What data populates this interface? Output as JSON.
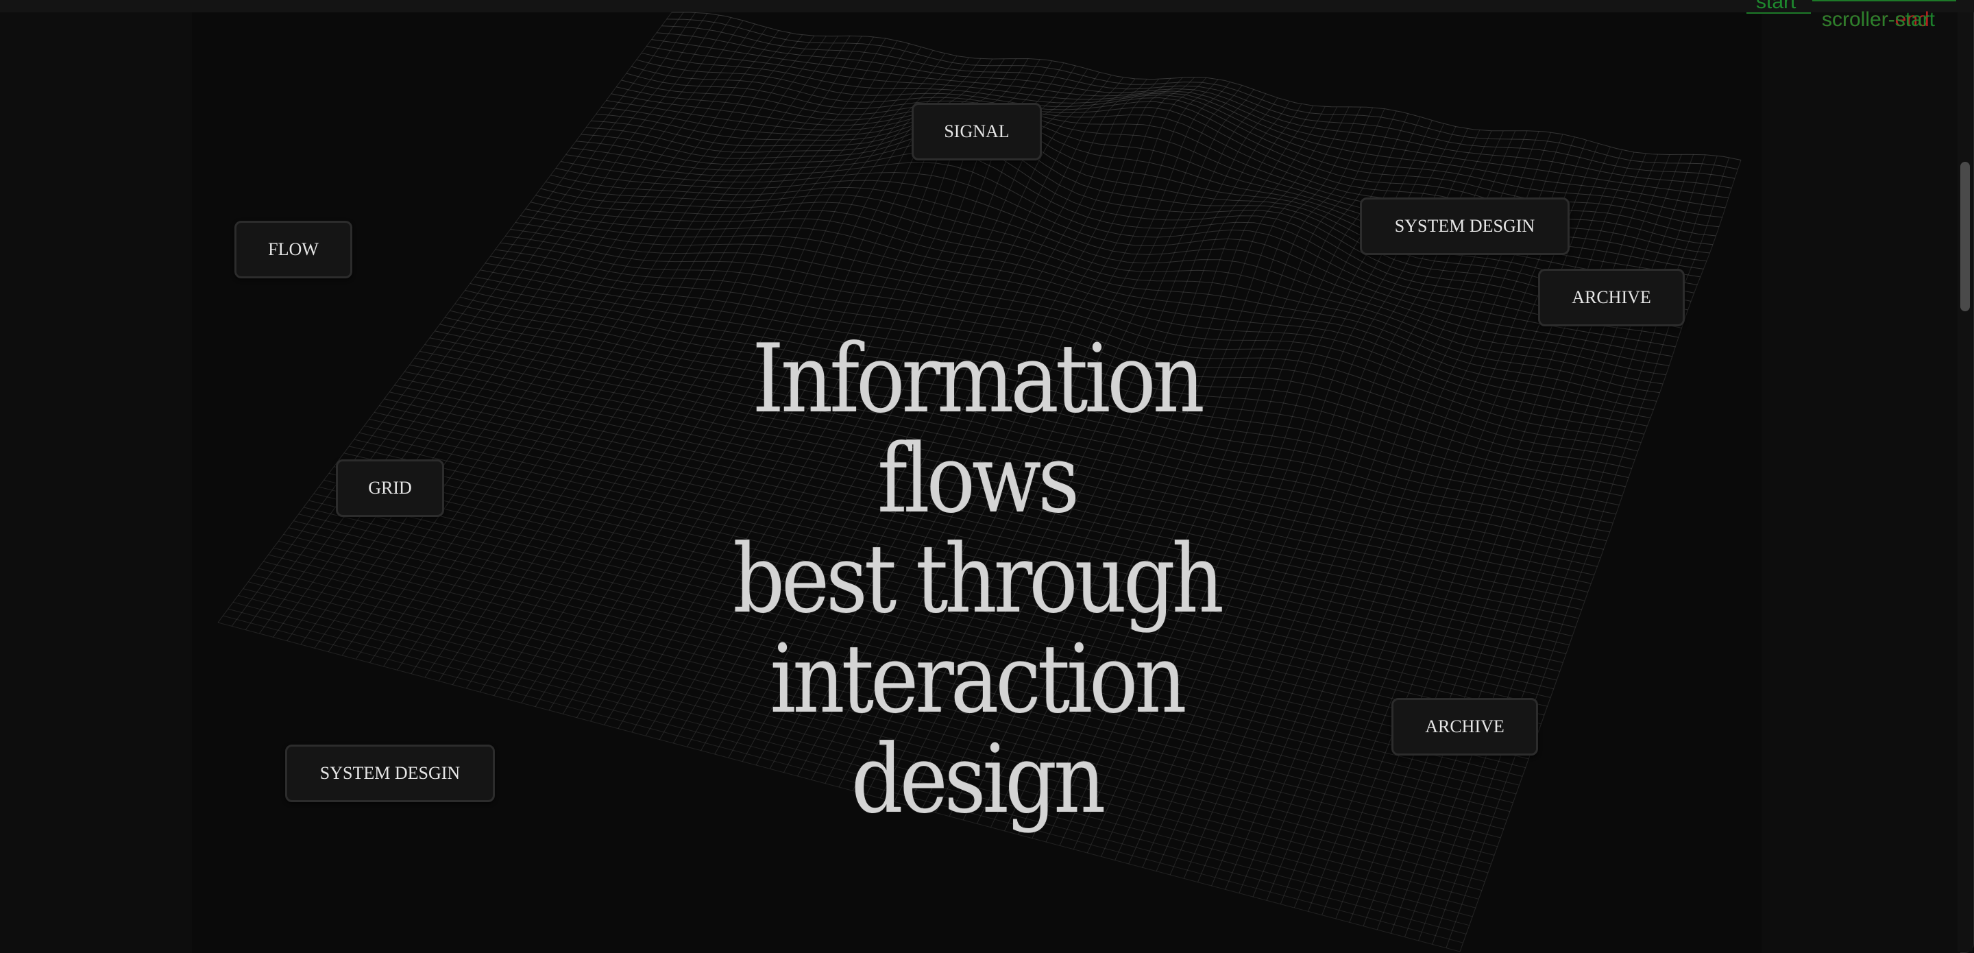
{
  "headline": {
    "line1": "Information flows",
    "line2": "best through",
    "line3": "interaction design"
  },
  "tags": {
    "signal": "SIGNAL",
    "flow": "FLOW",
    "system_design_top": "SYSTEM DESGIN",
    "archive_top": "ARCHIVE",
    "grid": "GRID",
    "archive_bottom": "ARCHIVE",
    "system_design_bottom": "SYSTEM DESGIN"
  },
  "debug_markers": {
    "start": "start",
    "scroller_start": "scroller-start",
    "scroller_end": "scroller-end"
  },
  "colors": {
    "background": "#0b0b0b",
    "mesh_line": "#5a5a5a",
    "headline_text": "#d4d4d4",
    "tag_background": "#151515",
    "tag_border": "#2c2c2c",
    "marker_start_green": "#1e8a2e",
    "marker_end_red": "#b32020"
  }
}
